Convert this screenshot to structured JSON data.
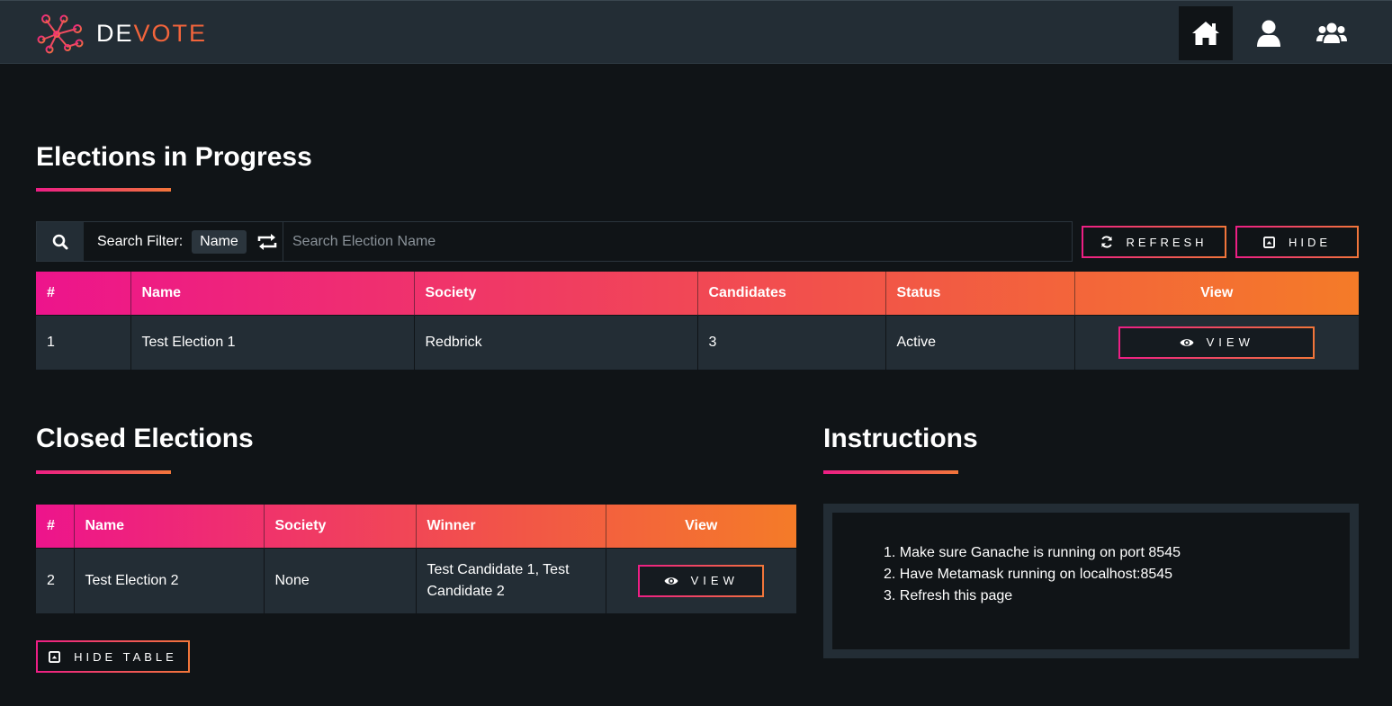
{
  "brand": {
    "part1": "DE",
    "part2": "VOTE"
  },
  "nav": {
    "home_label": "home",
    "profile_label": "profile",
    "groups_label": "groups"
  },
  "progress": {
    "title": "Elections in Progress",
    "search": {
      "filter_label": "Search Filter:",
      "filter_value": "Name",
      "placeholder": "Search Election Name"
    },
    "refresh_label": "REFRESH",
    "hide_label": "HIDE",
    "columns": [
      "#",
      "Name",
      "Society",
      "Candidates",
      "Status",
      "View"
    ],
    "rows": [
      {
        "num": "1",
        "name": "Test Election 1",
        "society": "Redbrick",
        "candidates": "3",
        "status": "Active",
        "view": "VIEW"
      }
    ]
  },
  "closed": {
    "title": "Closed Elections",
    "columns": [
      "#",
      "Name",
      "Society",
      "Winner",
      "View"
    ],
    "rows": [
      {
        "num": "2",
        "name": "Test Election 2",
        "society": "None",
        "winner": "Test Candidate 1, Test Candidate 2",
        "view": "VIEW"
      }
    ],
    "hide_table_label": "HIDE TABLE"
  },
  "instructions": {
    "title": "Instructions",
    "items": [
      "1. Make sure Ganache is running on port 8545",
      "2. Have Metamask running on localhost:8545",
      "3. Refresh this page"
    ]
  },
  "colors": {
    "accent_start": "#ed1e85",
    "accent_end": "#f2763a",
    "background": "#101417",
    "panel": "#232d35"
  }
}
